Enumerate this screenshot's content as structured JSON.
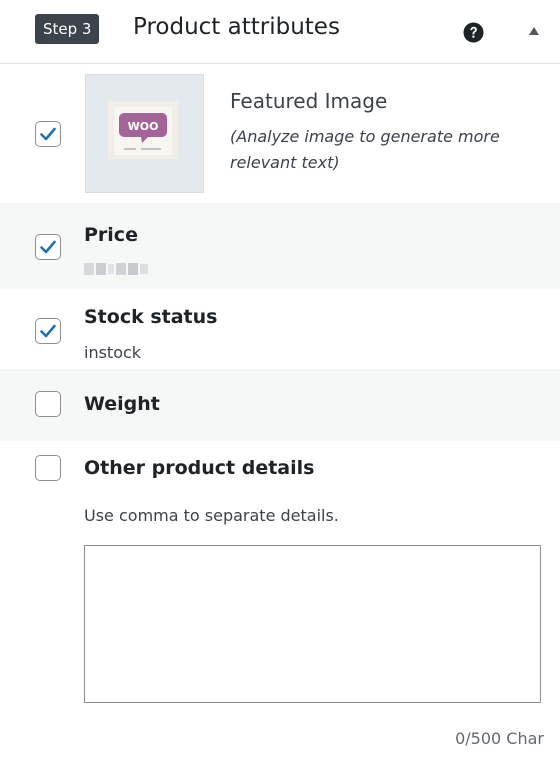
{
  "header": {
    "step_label": "Step 3",
    "title": "Product attributes",
    "help_icon": "question-circle-icon",
    "collapse_icon": "triangle-up-icon"
  },
  "featured_image": {
    "checked": true,
    "title": "Featured Image",
    "note": "(Analyze image to generate more relevant text)",
    "thumbnail_text": "WOO"
  },
  "attributes": {
    "price": {
      "checked": true,
      "label": "Price"
    },
    "stock_status": {
      "checked": true,
      "label": "Stock status",
      "value": "instock"
    },
    "weight": {
      "checked": false,
      "label": "Weight"
    },
    "other_details": {
      "checked": false,
      "label": "Other product details",
      "hint": "Use comma to separate details.",
      "value": "",
      "counter": "0/500 Char"
    }
  },
  "colors": {
    "accent": "#2271b1",
    "badge_bg": "#3c434a",
    "shaded_row": "#f6f7f7",
    "border": "#8c8f94",
    "woo_purple": "#9b5c8f"
  }
}
